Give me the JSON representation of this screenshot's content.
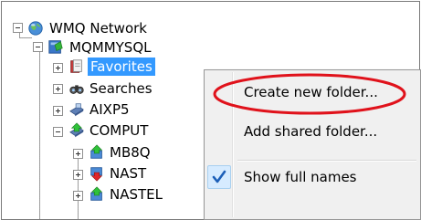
{
  "tree": {
    "root": {
      "label": "WMQ Network",
      "icon": "globe-icon"
    },
    "qmgr": {
      "label": "MQMMYSQL",
      "icon": "queue-manager-icon"
    },
    "items": [
      {
        "label": "Favorites",
        "icon": "favorites-folder-icon",
        "selected": true
      },
      {
        "label": "Searches",
        "icon": "searches-binoculars-icon"
      },
      {
        "label": "AIXP5",
        "icon": "computer-node-icon"
      },
      {
        "label": "COMPUT",
        "icon": "computer-node-green-icon"
      }
    ],
    "subitems": [
      {
        "label": "MB8Q",
        "icon": "queue-manager-green-icon"
      },
      {
        "label": "NAST",
        "icon": "queue-manager-red-icon"
      },
      {
        "label": "NASTEL",
        "icon": "queue-manager-green-icon"
      }
    ]
  },
  "context_menu": {
    "items": [
      {
        "label": "Create new folder..."
      },
      {
        "label": "Add shared folder..."
      },
      {
        "label": "Show full names",
        "checked": true
      }
    ]
  },
  "colors": {
    "selection": "#3399ff",
    "highlight_oval": "#e0121b",
    "menu_background": "#f0f0f0",
    "checkmark": "#1c5fb8"
  }
}
